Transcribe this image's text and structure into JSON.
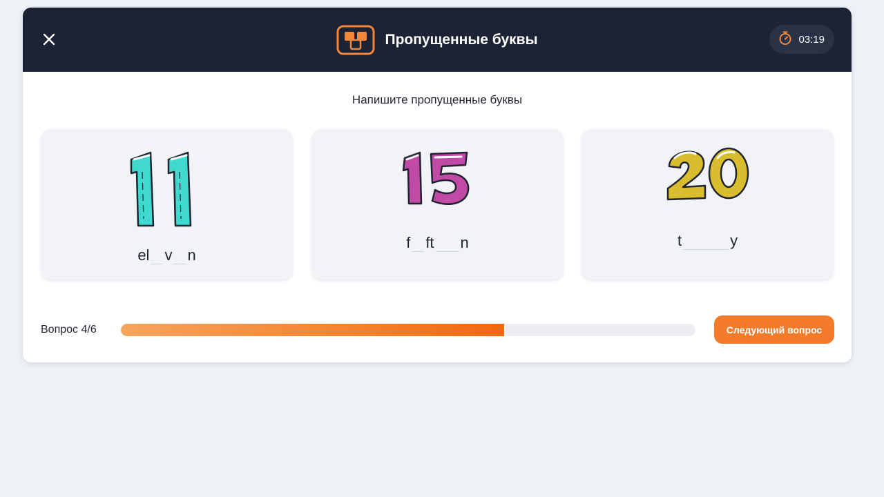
{
  "header": {
    "title": "Пропущенные буквы",
    "timer": "03:19",
    "close_icon": "close-icon",
    "app_icon": "tiles-icon",
    "timer_icon": "stopwatch-icon"
  },
  "instruction": "Напишите пропущенные буквы",
  "cards": [
    {
      "number": "11",
      "color": "#3fd9cf",
      "parts": [
        "el",
        "v",
        "n"
      ],
      "blank_count": 2
    },
    {
      "number": "15",
      "color": "#c04aa6",
      "parts": [
        "f",
        "ft",
        "n"
      ],
      "blank_count": 2
    },
    {
      "number": "20",
      "color": "#d9bd2e",
      "parts": [
        "t",
        "y"
      ],
      "blank_count": 1
    }
  ],
  "footer": {
    "question_label": "Вопрос 4/6",
    "progress": 0.667,
    "next_button": "Следующий вопрос"
  },
  "colors": {
    "header_bg": "#1c2335",
    "accent": "#f47b2a",
    "page_bg": "#eef1f5"
  }
}
